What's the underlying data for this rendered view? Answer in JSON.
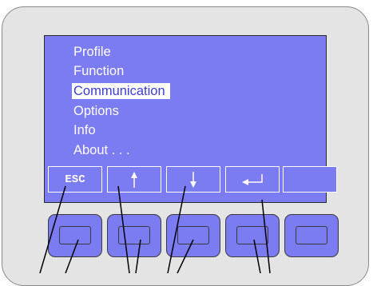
{
  "menu": {
    "items": [
      {
        "label": "Profile"
      },
      {
        "label": "Function"
      },
      {
        "label": "Communication",
        "selected": true
      },
      {
        "label": "Options"
      },
      {
        "label": "Info"
      },
      {
        "label": "About . . ."
      }
    ]
  },
  "softkeys": [
    {
      "label": "ESC",
      "icon": "text"
    },
    {
      "label": "",
      "icon": "arrow-up-icon"
    },
    {
      "label": "",
      "icon": "arrow-down-icon"
    },
    {
      "label": "",
      "icon": "enter-icon"
    },
    {
      "label": "",
      "icon": "none"
    }
  ],
  "colors": {
    "screen": "#7b7bf2",
    "highlight": "#ffffff",
    "bezel": "#e4e4e4",
    "button": "#7b7bf2"
  }
}
